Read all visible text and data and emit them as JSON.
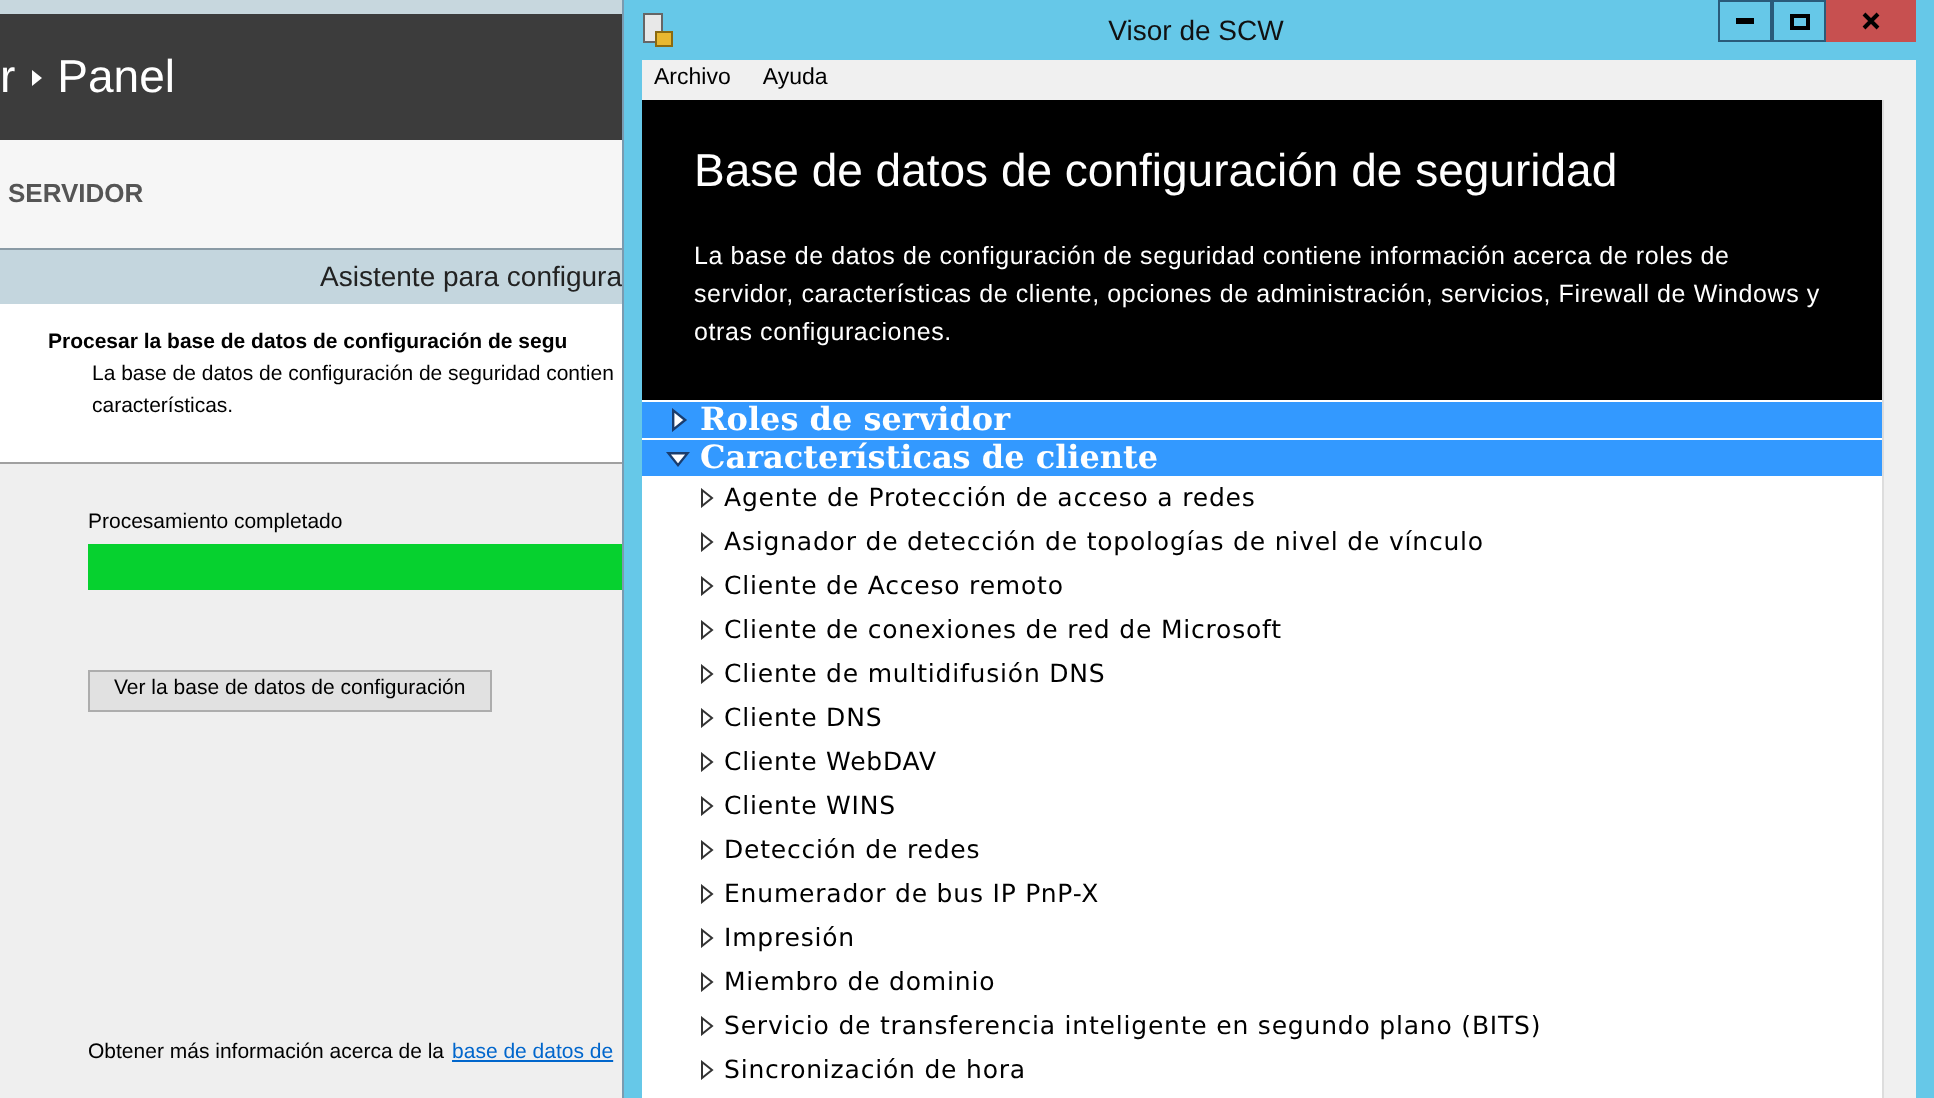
{
  "background_window": {
    "breadcrumb": "r",
    "breadcrumb_page": "Panel",
    "section_heading": "SERVIDOR",
    "wizard": {
      "title": "Asistente para configura",
      "step_title": "Procesar la base de datos de configuración de segu",
      "step_description": "La base de datos de configuración de seguridad contien",
      "step_description_2": "características.",
      "progress_label": "Procesamiento completado",
      "progress": {
        "level": 1
      },
      "view_button": "Ver la base de datos de configuración",
      "footer_text": "Obtener más información acerca de la",
      "footer_link": "base de datos de"
    }
  },
  "viewer_window": {
    "title": "Visor de SCW",
    "menu": [
      "Archivo",
      "Ayuda"
    ],
    "header": {
      "title": "Base de datos de configuración de seguridad",
      "description": "La base de datos de configuración de seguridad contiene información acerca de roles de servidor, características de cliente, opciones de administración, servicios, Firewall de Windows y otras configuraciones."
    },
    "sections": [
      {
        "label": "Roles de servidor",
        "expanded": false
      },
      {
        "label": "Características de cliente",
        "expanded": true,
        "items": [
          {
            "label": "Agente de Protección de acceso a redes",
            "expanded": false
          },
          {
            "label": "Asignador de detección de topologías de nivel de vínculo",
            "expanded": false
          },
          {
            "label": "Cliente de Acceso remoto",
            "expanded": false
          },
          {
            "label": "Cliente de conexiones de red de Microsoft",
            "expanded": false
          },
          {
            "label": "Cliente de multidifusión DNS",
            "expanded": false
          },
          {
            "label": "Cliente DNS",
            "expanded": false
          },
          {
            "label": "Cliente WebDAV",
            "expanded": false
          },
          {
            "label": "Cliente WINS",
            "expanded": false
          },
          {
            "label": "Detección de redes",
            "expanded": false
          },
          {
            "label": "Enumerador de bus IP PnP-X",
            "expanded": false
          },
          {
            "label": "Impresión",
            "expanded": false
          },
          {
            "label": "Miembro de dominio",
            "expanded": false
          },
          {
            "label": "Servicio de transferencia inteligente en segundo plano (BITS)",
            "expanded": false
          },
          {
            "label": "Sincronización de hora",
            "expanded": false
          }
        ]
      }
    ]
  }
}
